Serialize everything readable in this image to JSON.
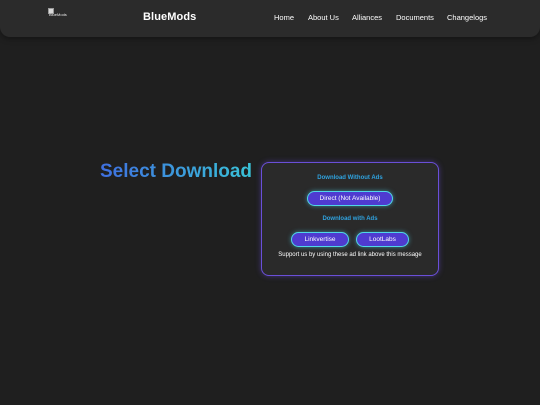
{
  "header": {
    "logo_alt": "BlueMods",
    "brand": "BlueMods",
    "nav": [
      "Home",
      "About Us",
      "Alliances",
      "Documents",
      "Changelogs"
    ]
  },
  "main": {
    "title": "Select Download",
    "card": {
      "no_ads_heading": "Download Without Ads",
      "direct_button": "Direct (Not Available)",
      "with_ads_heading": "Download with Ads",
      "linkvertise_button": "Linkvertise",
      "lootlabs_button": "LootLabs",
      "support_note": "Support us by using these ad link above this message"
    }
  },
  "colors": {
    "background": "#1f1f1f",
    "navbar": "#2b2b2b",
    "accent_purple": "#4f3bd0",
    "accent_cyan": "#4fd6e8",
    "heading_blue": "#2fa3e0"
  }
}
